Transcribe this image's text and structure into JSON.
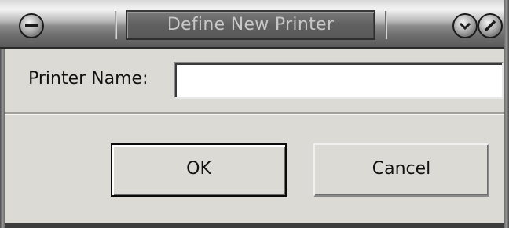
{
  "window": {
    "title": "Define New Printer"
  },
  "titlebar": {
    "left_button_icon": "minimize-icon",
    "right_buttons": [
      {
        "icon": "shade-down-icon"
      },
      {
        "icon": "close-slash-icon"
      }
    ]
  },
  "form": {
    "printer_name_label": "Printer Name:",
    "printer_name_value": ""
  },
  "buttons": {
    "ok_label": "OK",
    "cancel_label": "Cancel"
  }
}
